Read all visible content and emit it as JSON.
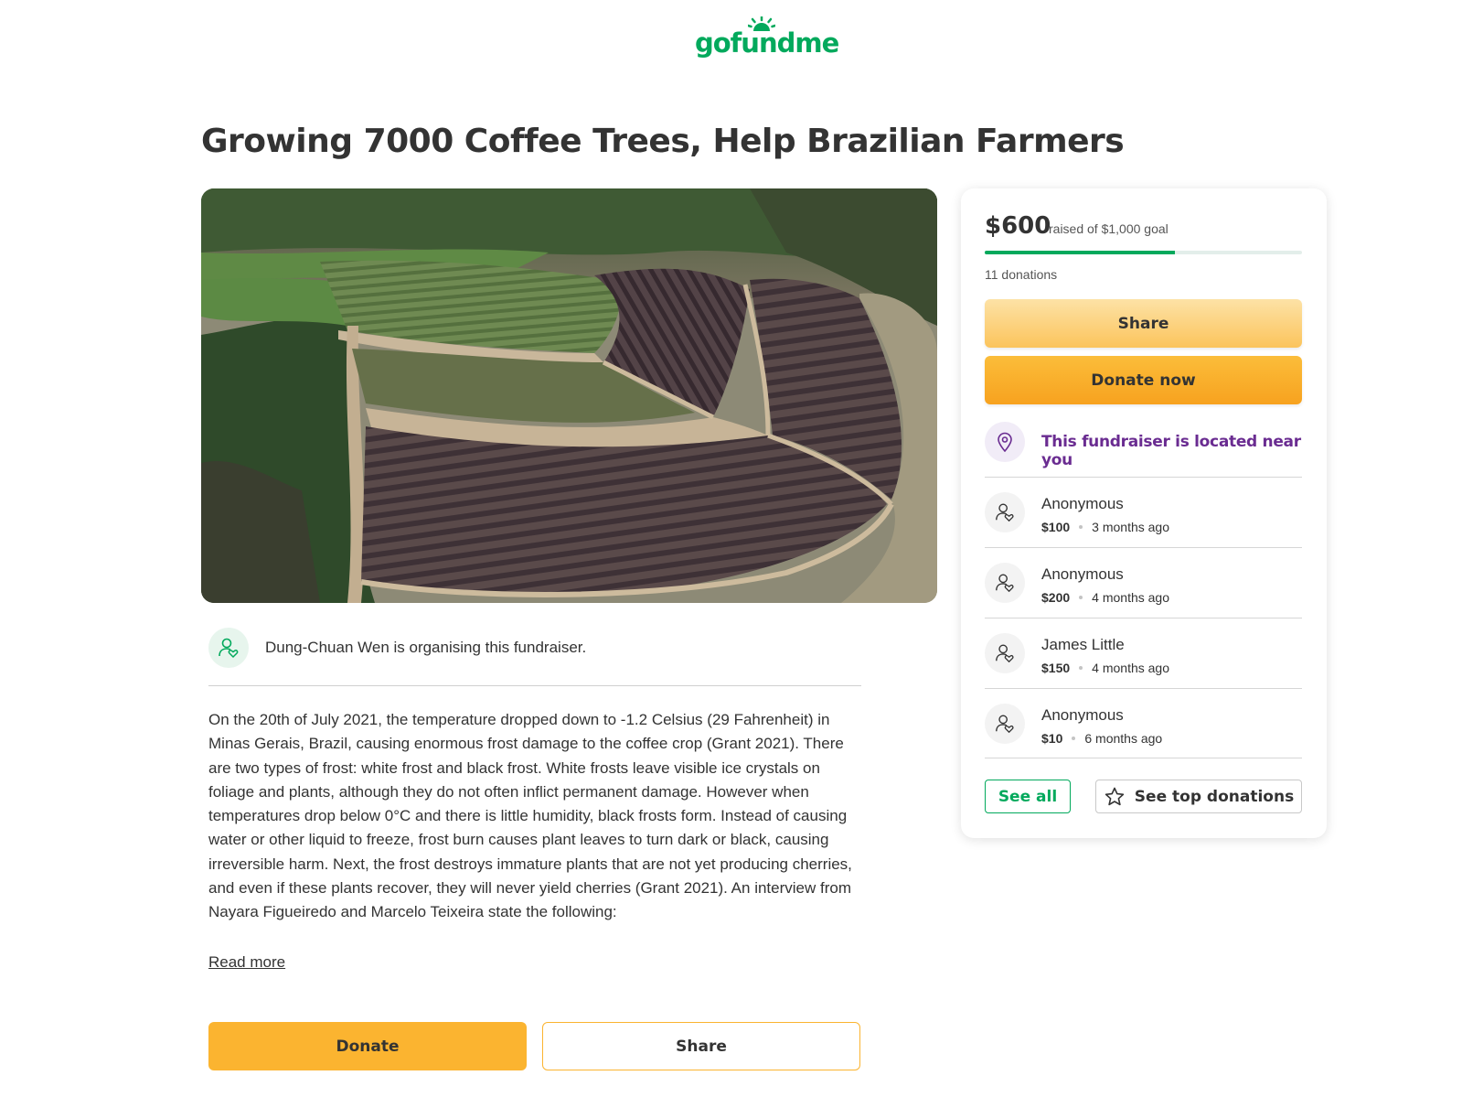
{
  "brand": {
    "name": "gofundme",
    "color": "#02a95c"
  },
  "campaign": {
    "title": "Growing 7000 Coffee Trees, Help Brazilian Farmers",
    "organiser_text": "Dung-Chuan Wen is organising this fundraiser.",
    "story": "On the 20th of July 2021, the temperature dropped down to -1.2 Celsius (29 Fahrenheit) in Minas Gerais, Brazil, causing enormous frost damage to the coffee crop (Grant 2021). There are two types of frost: white frost and black frost. White frosts leave visible ice crystals on foliage and plants, although they do not often inflict permanent damage. However when temperatures drop below 0°C and there is little humidity, black frosts form. Instead of causing water or other liquid to freeze, frost burn causes plant leaves to turn dark or black, causing irreversible harm. Next, the frost destroys immature plants that are not yet producing cherries, and even if these plants recover, they will never yield cherries (Grant 2021). An interview from Nayara Figueiredo and Marcelo Teixeira state the following:",
    "read_more": "Read more",
    "donate_label": "Donate",
    "share_label": "Share"
  },
  "sidebar": {
    "amount_raised": "$600",
    "goal_text": "raised of $1,000 goal",
    "progress_fraction": 0.6,
    "donations_count": "11 donations",
    "share_label": "Share",
    "donate_now_label": "Donate now",
    "nearby_text": "This fundraiser is located near you",
    "donors": [
      {
        "name": "Anonymous",
        "amount": "$100",
        "time": "3 months ago"
      },
      {
        "name": "Anonymous",
        "amount": "$200",
        "time": "4 months ago"
      },
      {
        "name": "James Little",
        "amount": "$150",
        "time": "4 months ago"
      },
      {
        "name": "Anonymous",
        "amount": "$10",
        "time": "6 months ago"
      }
    ],
    "see_all_label": "See all",
    "see_top_label": "See top donations"
  },
  "icons": {
    "organiser": "person-heart-icon",
    "location": "map-pin-icon",
    "donor": "person-heart-icon",
    "star": "star-icon"
  },
  "colors": {
    "accent_green": "#02a95c",
    "donate_orange": "#fbb430",
    "location_purple": "#6a2c91"
  }
}
